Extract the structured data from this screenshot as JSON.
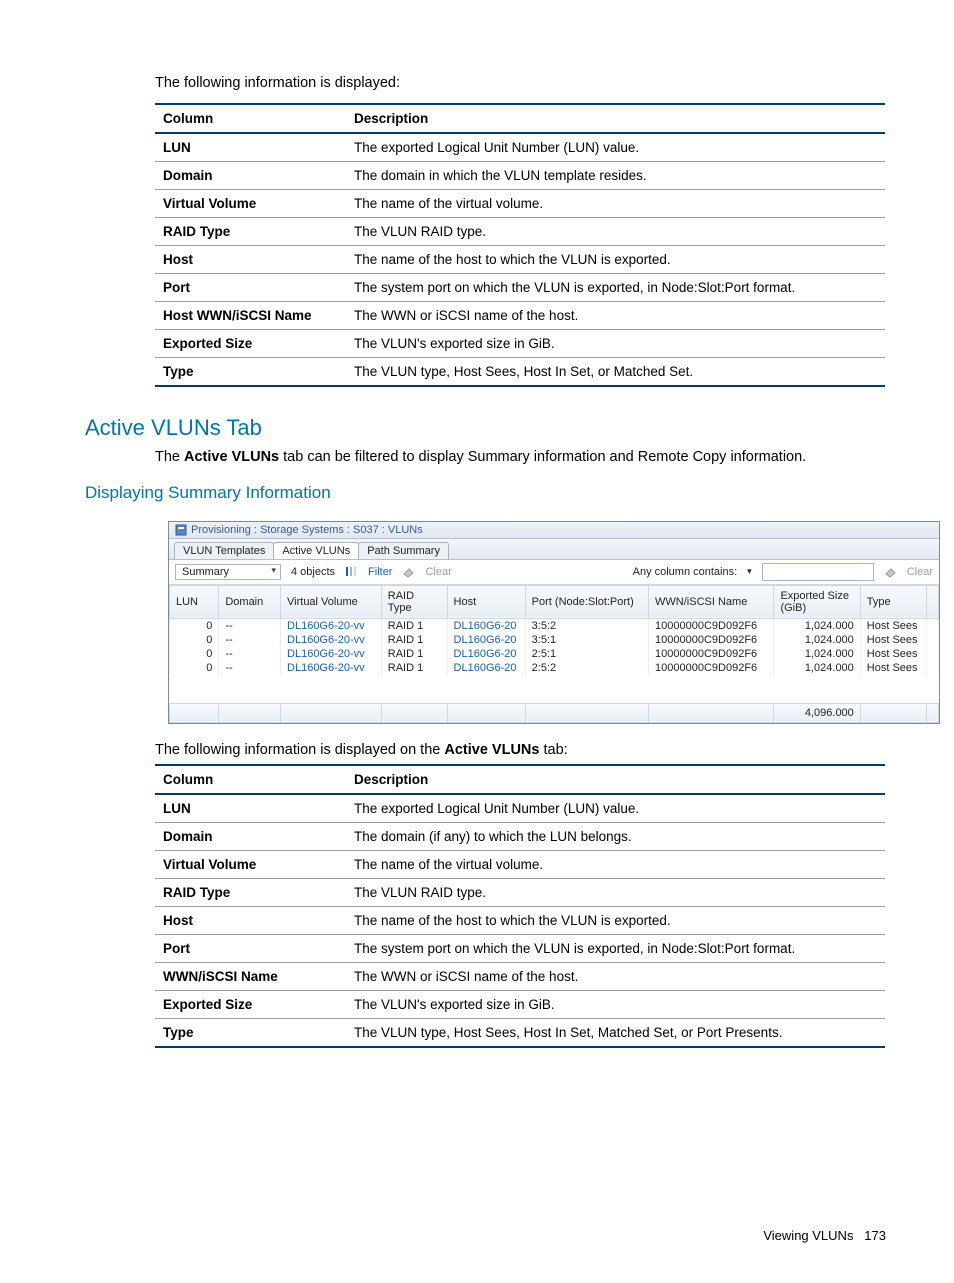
{
  "intro1": "The following information is displayed:",
  "table1": {
    "head": [
      "Column",
      "Description"
    ],
    "rows": [
      [
        "LUN",
        "The exported Logical Unit Number (LUN) value."
      ],
      [
        "Domain",
        "The domain in which the VLUN template resides."
      ],
      [
        "Virtual Volume",
        "The name of the virtual volume."
      ],
      [
        "RAID Type",
        "The VLUN RAID type."
      ],
      [
        "Host",
        "The name of the host to which the VLUN is exported."
      ],
      [
        "Port",
        "The system port on which the VLUN is exported, in Node:Slot:Port format."
      ],
      [
        "Host WWN/iSCSI Name",
        "The WWN or iSCSI name of the host."
      ],
      [
        "Exported Size",
        "The VLUN's exported size in GiB."
      ],
      [
        "Type",
        "The VLUN type, Host Sees, Host In Set, or Matched Set."
      ]
    ]
  },
  "h2": "Active VLUNs Tab",
  "para_active_pre": "The ",
  "para_active_strong": "Active VLUNs",
  "para_active_post": " tab can be filtered to display Summary information and Remote Copy information.",
  "h3": "Displaying Summary Information",
  "app": {
    "title": "Provisioning : Storage Systems : S037 : VLUNs",
    "tabs": [
      "VLUN Templates",
      "Active VLUNs",
      "Path Summary"
    ],
    "active_tab": 1,
    "toolbar": {
      "dropdown": "Summary",
      "objects": "4 objects",
      "filter": "Filter",
      "clear1": "Clear",
      "any_col": "Any column contains:",
      "clear2": "Clear"
    },
    "columns": [
      "LUN",
      "Domain",
      "Virtual Volume",
      "RAID Type",
      "Host",
      "Port (Node:Slot:Port)",
      "WWN/iSCSI Name",
      "Exported Size (GiB)",
      "Type"
    ],
    "rows": [
      {
        "lun": "0",
        "domain": "--",
        "vv": "DL160G6-20-vv",
        "raid": "RAID 1",
        "host": "DL160G6-20",
        "port": "3:5:2",
        "wwn": "10000000C9D092F6",
        "size": "1,024.000",
        "type": "Host Sees"
      },
      {
        "lun": "0",
        "domain": "--",
        "vv": "DL160G6-20-vv",
        "raid": "RAID 1",
        "host": "DL160G6-20",
        "port": "3:5:1",
        "wwn": "10000000C9D092F6",
        "size": "1,024.000",
        "type": "Host Sees"
      },
      {
        "lun": "0",
        "domain": "--",
        "vv": "DL160G6-20-vv",
        "raid": "RAID 1",
        "host": "DL160G6-20",
        "port": "2:5:1",
        "wwn": "10000000C9D092F6",
        "size": "1,024.000",
        "type": "Host Sees"
      },
      {
        "lun": "0",
        "domain": "--",
        "vv": "DL160G6-20-vv",
        "raid": "RAID 1",
        "host": "DL160G6-20",
        "port": "2:5:2",
        "wwn": "10000000C9D092F6",
        "size": "1,024.000",
        "type": "Host Sees"
      }
    ],
    "total_size": "4,096.000"
  },
  "intro2_pre": "The following information is displayed on the ",
  "intro2_strong": "Active VLUNs",
  "intro2_post": " tab:",
  "table2": {
    "head": [
      "Column",
      "Description"
    ],
    "rows": [
      [
        "LUN",
        "The exported Logical Unit Number (LUN) value."
      ],
      [
        "Domain",
        "The domain (if any) to which the LUN belongs."
      ],
      [
        "Virtual Volume",
        "The name of the virtual volume."
      ],
      [
        "RAID Type",
        "The VLUN RAID type."
      ],
      [
        "Host",
        "The name of the host to which the VLUN is exported."
      ],
      [
        "Port",
        "The system port on which the VLUN is exported, in Node:Slot:Port format."
      ],
      [
        "WWN/iSCSI Name",
        "The WWN or iSCSI name of the host."
      ],
      [
        "Exported Size",
        "The VLUN's exported size in GiB."
      ],
      [
        "Type",
        "The VLUN type, Host Sees, Host In Set, Matched Set, or Port Presents."
      ]
    ]
  },
  "footer_text": "Viewing VLUNs",
  "footer_page": "173"
}
